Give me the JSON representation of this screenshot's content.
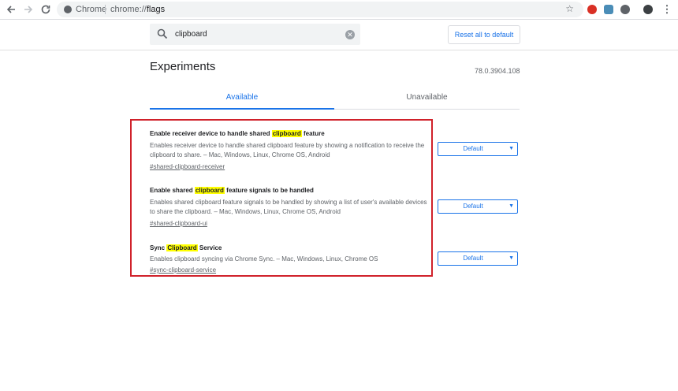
{
  "browser": {
    "site_label": "Chrome",
    "url_prefix": "chrome://",
    "url_path": "flags",
    "icons": [
      "back-arrow-icon",
      "forward-arrow-icon",
      "reload-icon",
      "star-icon",
      "menu-dots-icon"
    ]
  },
  "header": {
    "search_value": "clipboard",
    "reset_label": "Reset all to default"
  },
  "page": {
    "title": "Experiments",
    "version": "78.0.3904.108"
  },
  "tabs": [
    {
      "label": "Available",
      "active": true
    },
    {
      "label": "Unavailable",
      "active": false
    }
  ],
  "experiments": [
    {
      "title_before": "Enable receiver device to handle shared ",
      "title_highlight": "clipboard",
      "title_after": " feature",
      "description": "Enables receiver device to handle shared clipboard feature by showing a notification to receive the clipboard to share. – Mac, Windows, Linux, Chrome OS, Android",
      "link": "#shared-clipboard-receiver",
      "select_value": "Default"
    },
    {
      "title_before": "Enable shared ",
      "title_highlight": "clipboard",
      "title_after": " feature signals to be handled",
      "description": "Enables shared clipboard feature signals to be handled by showing a list of user's available devices to share the clipboard. – Mac, Windows, Linux, Chrome OS, Android",
      "link": "#shared-clipboard-ui",
      "select_value": "Default"
    },
    {
      "title_before": "Sync ",
      "title_highlight": "Clipboard",
      "title_after": " Service",
      "description": "Enables clipboard syncing via Chrome Sync. – Mac, Windows, Linux, Chrome OS",
      "link": "#sync-clipboard-service",
      "select_value": "Default"
    }
  ],
  "colors": {
    "accent": "#1a73e8",
    "highlight": "#ffff00",
    "annotation_frame": "#d0212a"
  }
}
